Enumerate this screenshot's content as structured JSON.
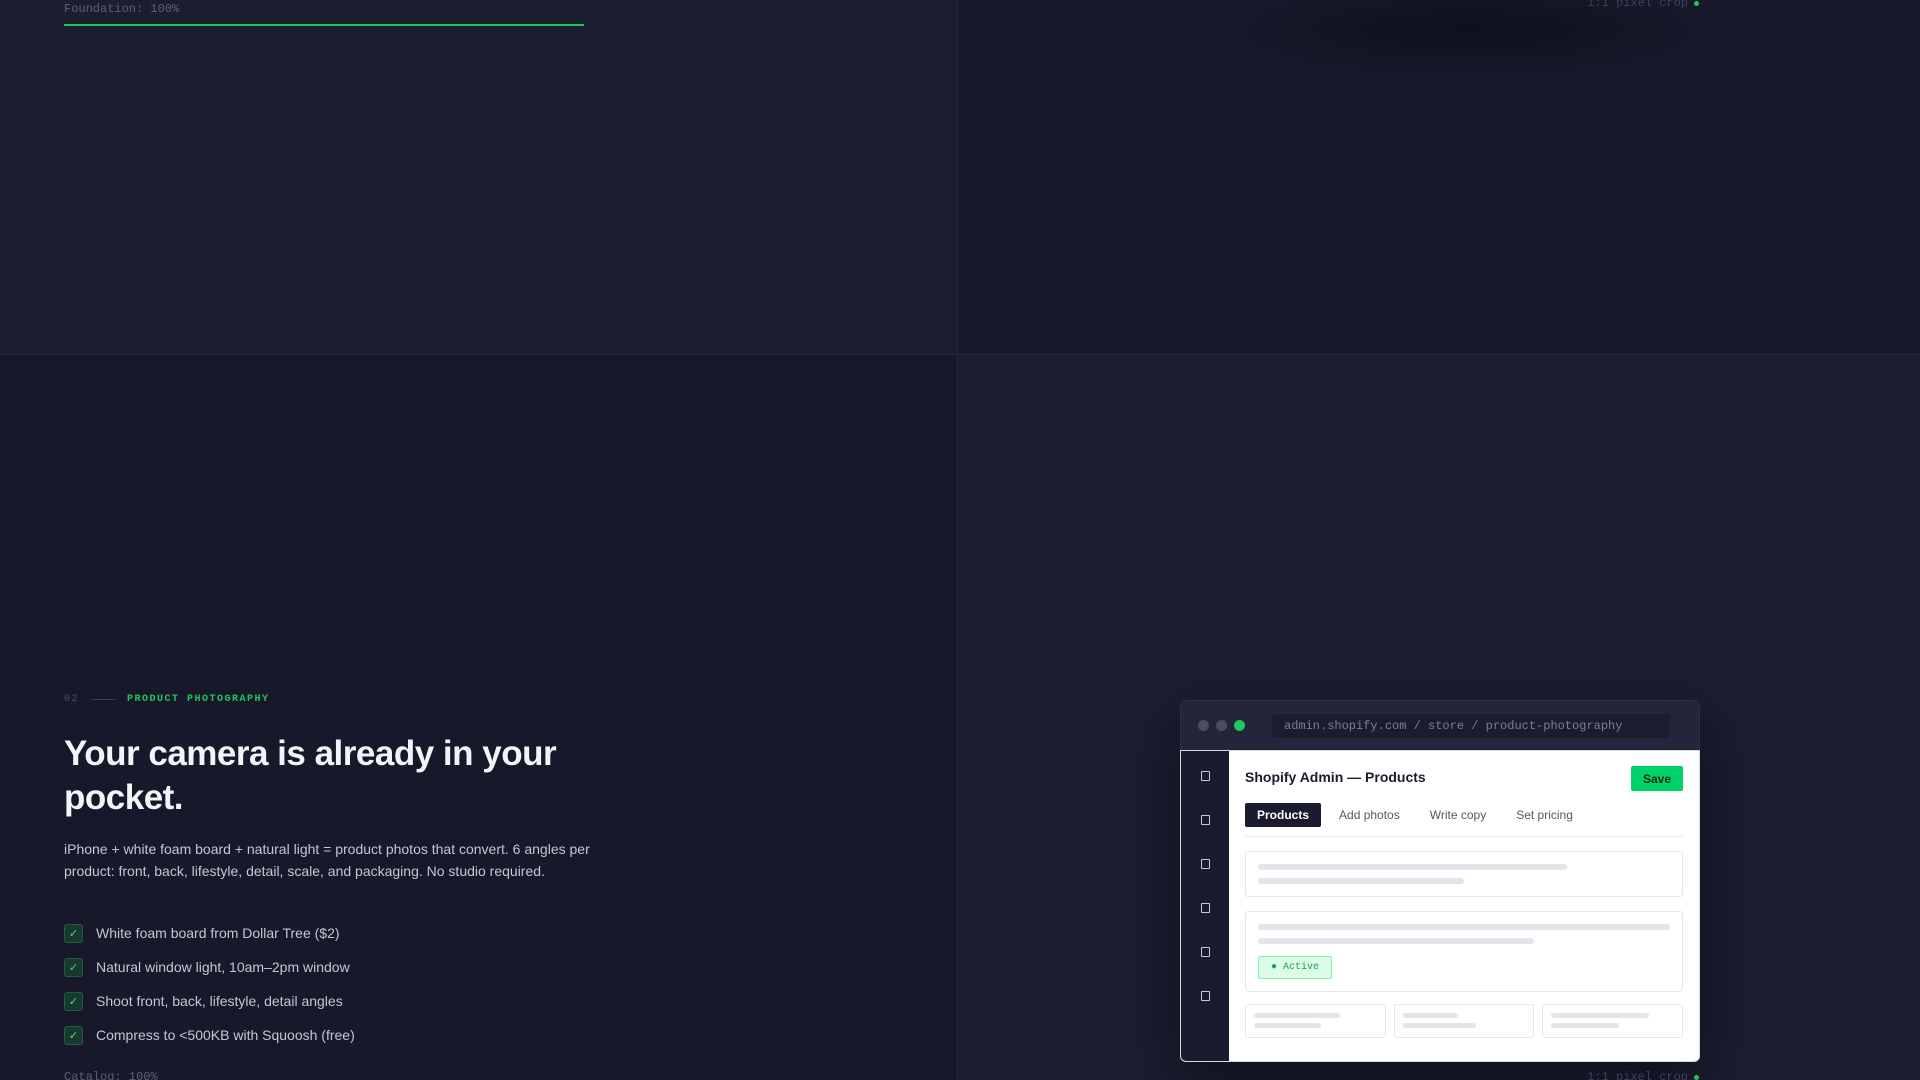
{
  "foundation": {
    "label": "Foundation: 100%",
    "progress": 1.0
  },
  "crop_label_top": "1:1 pixel crop",
  "section": {
    "number": "02",
    "eyebrow": "PRODUCT PHOTOGRAPHY",
    "headline": "Your camera is already in your pocket.",
    "description": "iPhone + white foam board + natural light = product photos that convert. 6 angles per product: front, back, lifestyle, detail, scale, and packaging. No studio required.",
    "checklist": [
      "White foam board from Dollar Tree ($2)",
      "Natural window light, 10am–2pm window",
      "Shoot front, back, lifestyle, detail angles",
      "Compress to <500KB with Squoosh (free)"
    ],
    "catalog_label": "Catalog: 100%"
  },
  "crop_label_bottom": "1:1 pixel crop",
  "browser": {
    "url": "admin.shopify.com / store / product-photography",
    "app_title": "Shopify Admin — Products",
    "save_label": "Save",
    "tabs": [
      "Products",
      "Add photos",
      "Write copy",
      "Set pricing"
    ],
    "active_tab": "Products",
    "status_badge": "● Active"
  },
  "colors": {
    "accent": "#22c55e",
    "save_button": "#00d26a",
    "background": "#181a2b"
  }
}
